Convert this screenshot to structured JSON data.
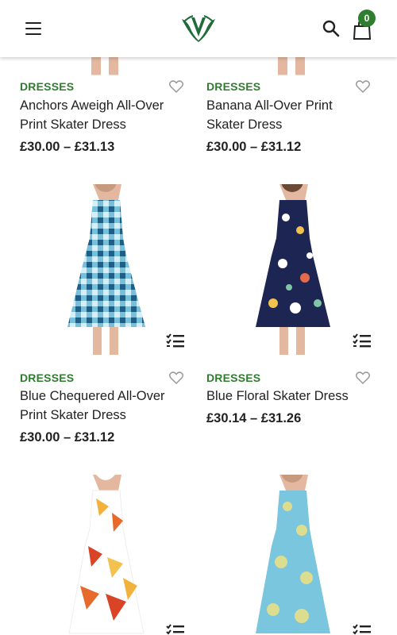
{
  "header": {
    "menu_icon": "hamburger-menu-icon",
    "logo": "shop-logo",
    "search_icon": "search-icon",
    "cart_icon": "shopping-bag-icon",
    "cart_count": "0",
    "brand_color": "#2f7d2f"
  },
  "products": [
    {
      "category": "DRESSES",
      "name": "Anchors Aweigh All-Over Print Skater Dress",
      "price": "£30.00 – £31.13"
    },
    {
      "category": "DRESSES",
      "name": "Banana All-Over Print Skater Dress",
      "price": "£30.00 – £31.12"
    },
    {
      "category": "DRESSES",
      "name": "Blue Chequered All-Over Print Skater Dress",
      "price": "£30.00 – £31.12"
    },
    {
      "category": "DRESSES",
      "name": "Blue Floral Skater Dress",
      "price": "£30.14 – £31.26"
    },
    {
      "category": "",
      "name": "",
      "price": ""
    },
    {
      "category": "",
      "name": "",
      "price": ""
    }
  ]
}
